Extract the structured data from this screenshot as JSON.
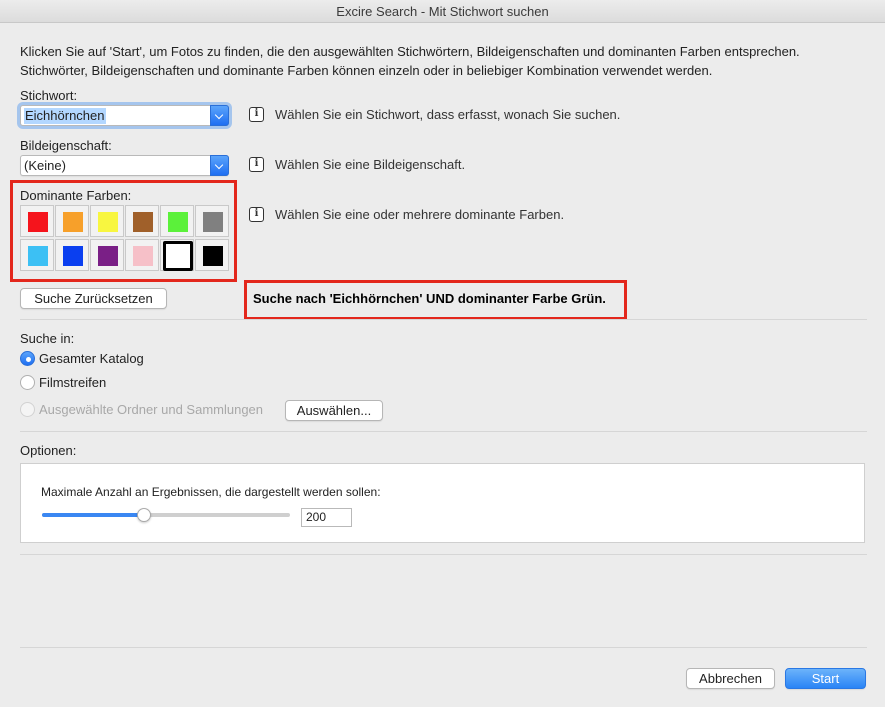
{
  "window": {
    "title": "Excire Search - Mit Stichwort suchen"
  },
  "intro": {
    "line1": "Klicken Sie auf 'Start', um Fotos zu finden, die den ausgewählten Stichwörtern, Bildeigenschaften und dominanten Farben entsprechen.",
    "line2": "Stichwörter, Bildeigenschaften und dominante Farben können einzeln oder in beliebiger Kombination verwendet werden."
  },
  "keyword": {
    "label": "Stichwort:",
    "value": "Eichhörnchen",
    "hint": "Wählen Sie ein Stichwort, dass erfasst, wonach Sie suchen."
  },
  "property": {
    "label": "Bildeigenschaft:",
    "value": "(Keine)",
    "hint": "Wählen Sie eine Bildeigenschaft."
  },
  "colors": {
    "label": "Dominante Farben:",
    "hint": "Wählen Sie eine oder mehrere dominante Farben.",
    "row1": [
      "#f5141c",
      "#f7a02a",
      "#f8f640",
      "#a0602a",
      "#5bf13a",
      "#808080"
    ],
    "row2": [
      "#3cc0f4",
      "#0a3ff0",
      "#7a1f86",
      "#f6c0c8",
      "#ffffff",
      "#000000"
    ],
    "selected_row": 1,
    "selected_index": 4
  },
  "reset_button": "Suche Zurücksetzen",
  "status": "Suche nach 'Eichhörnchen' UND dominanter Farbe Grün.",
  "search_in": {
    "label": "Suche in:",
    "option_catalog": "Gesamter Katalog",
    "option_filmstrip": "Filmstreifen",
    "option_folders": "Ausgewählte Ordner und Sammlungen",
    "select_button": "Auswählen...",
    "selected": "catalog"
  },
  "options": {
    "label": "Optionen:",
    "max_results_label": "Maximale Anzahl an Ergebnissen, die dargestellt werden sollen:",
    "max_results_value": "200",
    "slider_fraction": 0.41
  },
  "footer": {
    "cancel": "Abbrechen",
    "start": "Start"
  },
  "accent_color": "#2a84f6",
  "highlight_color": "#e3271c"
}
